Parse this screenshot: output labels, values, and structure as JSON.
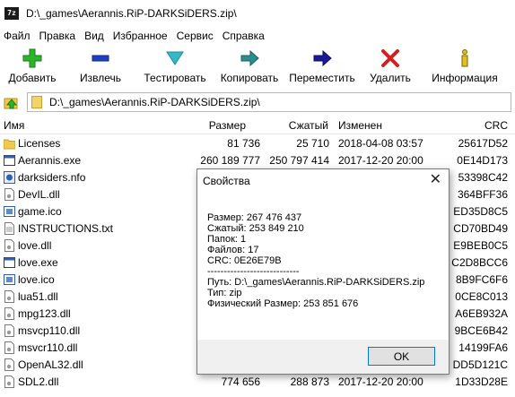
{
  "window": {
    "title": "D:\\_games\\Aerannis.RiP-DARKSiDERS.zip\\",
    "app_icon_text": "7z"
  },
  "menu": [
    "Файл",
    "Правка",
    "Вид",
    "Избранное",
    "Сервис",
    "Справка"
  ],
  "toolbar": [
    {
      "label": "Добавить",
      "icon": "add-icon",
      "color": "#2bb52b"
    },
    {
      "label": "Извлечь",
      "icon": "extract-icon",
      "color": "#1e3fbf"
    },
    {
      "label": "Тестировать",
      "icon": "test-icon",
      "color": "#35b9c9"
    },
    {
      "label": "Копировать",
      "icon": "copy-icon",
      "color": "#2a8f8f"
    },
    {
      "label": "Переместить",
      "icon": "move-icon",
      "color": "#1a1a99"
    },
    {
      "label": "Удалить",
      "icon": "delete-icon",
      "color": "#d22020"
    },
    {
      "label": "Информация",
      "icon": "info-icon",
      "color": "#e0c020"
    }
  ],
  "address": {
    "path": "D:\\_games\\Aerannis.RiP-DARKSiDERS.zip\\"
  },
  "columns": {
    "name": "Имя",
    "size": "Размер",
    "packed": "Сжатый",
    "modified": "Изменен",
    "crc": "CRC"
  },
  "files": [
    {
      "name": "Licenses",
      "icon": "folder-icon",
      "size": "81 736",
      "packed": "25 710",
      "modified": "2018-04-08 03:57",
      "crc": "25617D52"
    },
    {
      "name": "Aerannis.exe",
      "icon": "exe-icon",
      "size": "260 189 777",
      "packed": "250 797 414",
      "modified": "2017-12-20 20:00",
      "crc": "0E14D173"
    },
    {
      "name": "darksiders.nfo",
      "icon": "nfo-icon",
      "size": "",
      "packed": "",
      "modified": "",
      "crc": "53398C42"
    },
    {
      "name": "DevIL.dll",
      "icon": "dll-icon",
      "size": "",
      "packed": "",
      "modified": "",
      "crc": "364BFF36"
    },
    {
      "name": "game.ico",
      "icon": "ico-icon",
      "size": "",
      "packed": "",
      "modified": "",
      "crc": "ED35D8C5"
    },
    {
      "name": "INSTRUCTIONS.txt",
      "icon": "txt-icon",
      "size": "",
      "packed": "",
      "modified": "",
      "crc": "CD70BD49"
    },
    {
      "name": "love.dll",
      "icon": "dll-icon",
      "size": "",
      "packed": "",
      "modified": "",
      "crc": "E9BEB0C5"
    },
    {
      "name": "love.exe",
      "icon": "exe-icon",
      "size": "",
      "packed": "",
      "modified": "",
      "crc": "C2D8BCC6"
    },
    {
      "name": "love.ico",
      "icon": "ico-icon",
      "size": "",
      "packed": "",
      "modified": "",
      "crc": "8B9FC6F6"
    },
    {
      "name": "lua51.dll",
      "icon": "dll-icon",
      "size": "",
      "packed": "",
      "modified": "",
      "crc": "0CE8C013"
    },
    {
      "name": "mpg123.dll",
      "icon": "dll-icon",
      "size": "",
      "packed": "",
      "modified": "",
      "crc": "A6EB932A"
    },
    {
      "name": "msvcp110.dll",
      "icon": "dll-icon",
      "size": "",
      "packed": "",
      "modified": "",
      "crc": "9BCE6B42"
    },
    {
      "name": "msvcr110.dll",
      "icon": "dll-icon",
      "size": "",
      "packed": "",
      "modified": "",
      "crc": "14199FA6"
    },
    {
      "name": "OpenAL32.dll",
      "icon": "dll-icon",
      "size": "",
      "packed": "",
      "modified": "",
      "crc": "DD5D121C"
    },
    {
      "name": "SDL2.dll",
      "icon": "dll-icon",
      "size": "774 656",
      "packed": "288 873",
      "modified": "2017-12-20 20:00",
      "crc": "1D33D28E"
    }
  ],
  "dialog": {
    "title": "Свойства",
    "lines": [
      "Размер: 267 476 437",
      "Сжатый: 253 849 210",
      "Папок: 1",
      "Файлов: 17",
      "CRC: 0E26E79B",
      "----------------------------",
      "Путь: D:\\_games\\Aerannis.RiP-DARKSiDERS.zip",
      "Тип: zip",
      "Физический Размер: 253 851 676"
    ],
    "ok_label": "OK",
    "close_glyph": "✕"
  }
}
